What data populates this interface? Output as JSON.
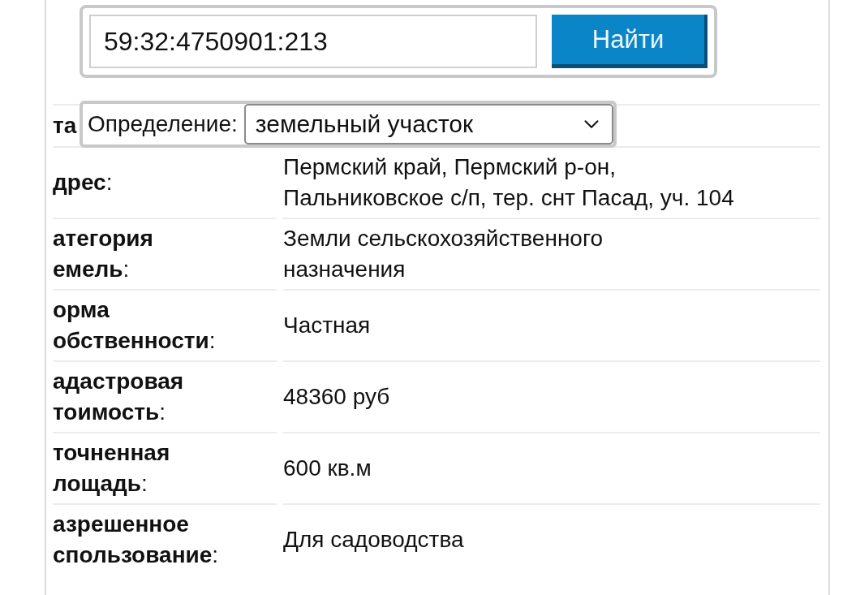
{
  "search": {
    "value": "59:32:4750901:213",
    "button": "Найти"
  },
  "definition": {
    "label": "Определение:",
    "value": "земельный участок"
  },
  "rows": [
    {
      "label": [
        "**та**"
      ],
      "value": []
    },
    {
      "label": [
        "**дрес**:"
      ],
      "value": [
        "Пермский край, Пермский р-он,",
        "Пальниковское с/п, тер. снт Пасад, уч. 104"
      ]
    },
    {
      "label": [
        "**атегория**",
        "**емель**:"
      ],
      "value": [
        "Земли сельскохозяйственного",
        "назначения"
      ]
    },
    {
      "label": [
        "**орма**",
        "**обственности**:"
      ],
      "value": [
        "Частная"
      ]
    },
    {
      "label": [
        "**адастровая**",
        "**тоимость**:"
      ],
      "value": [
        "48360 руб"
      ]
    },
    {
      "label": [
        "**точненная**",
        "**лощадь**:"
      ],
      "value": [
        "600 кв.м"
      ]
    },
    {
      "label": [
        "**азрешенное**",
        "**спользование**:"
      ],
      "value": [
        "Для садоводства"
      ]
    }
  ]
}
